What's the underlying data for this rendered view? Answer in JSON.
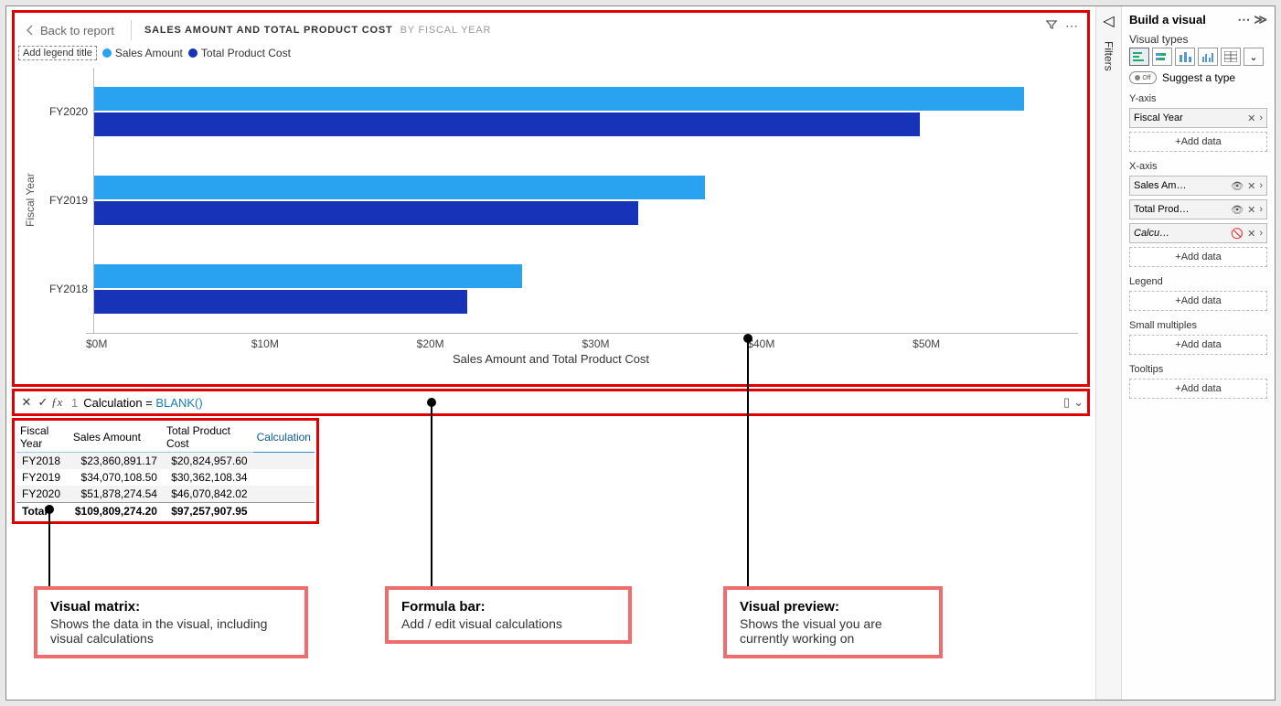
{
  "header": {
    "back_label": "Back to report",
    "title_main": "SALES AMOUNT AND TOTAL PRODUCT COST",
    "title_sub": "BY FISCAL YEAR"
  },
  "legend": {
    "placeholder": "Add legend title",
    "items": [
      {
        "label": "Sales Amount",
        "color": "#29a3ef"
      },
      {
        "label": "Total Product Cost",
        "color": "#1733b8"
      }
    ]
  },
  "chart_data": {
    "type": "bar",
    "orientation": "horizontal",
    "categories": [
      "FY2020",
      "FY2019",
      "FY2018"
    ],
    "series": [
      {
        "name": "Sales Amount",
        "color": "#29a3ef",
        "values": [
          51.88,
          34.07,
          23.86
        ]
      },
      {
        "name": "Total Product Cost",
        "color": "#1733b8",
        "values": [
          46.07,
          30.36,
          20.82
        ]
      }
    ],
    "ylabel": "Fiscal Year",
    "xlabel": "Sales Amount and Total Product Cost",
    "xticks": [
      "$0M",
      "$10M",
      "$20M",
      "$30M",
      "$40M",
      "$50M"
    ],
    "xlim": [
      0,
      55
    ]
  },
  "formula": {
    "line_no": "1",
    "body_plain": "Calculation = ",
    "body_func": "BLANK()"
  },
  "matrix": {
    "headers": [
      "Fiscal Year",
      "Sales Amount",
      "Total Product Cost",
      "Calculation"
    ],
    "rows": [
      {
        "fy": "FY2018",
        "sales": "$23,860,891.17",
        "cost": "$20,824,957.60",
        "calc": ""
      },
      {
        "fy": "FY2019",
        "sales": "$34,070,108.50",
        "cost": "$30,362,108.34",
        "calc": ""
      },
      {
        "fy": "FY2020",
        "sales": "$51,878,274.54",
        "cost": "$46,070,842.02",
        "calc": ""
      }
    ],
    "total": {
      "fy": "Total",
      "sales": "$109,809,274.20",
      "cost": "$97,257,907.95",
      "calc": ""
    }
  },
  "callouts": {
    "matrix": {
      "title": "Visual matrix:",
      "body": "Shows the data in the visual, including visual calculations"
    },
    "formula": {
      "title": "Formula bar:",
      "body": "Add / edit visual calculations"
    },
    "preview": {
      "title": "Visual preview:",
      "body": "Shows the visual you are currently working on"
    }
  },
  "filters_rail": {
    "label": "Filters"
  },
  "panel": {
    "title": "Build a visual",
    "visual_types_label": "Visual types",
    "suggest_label": "Suggest a type",
    "suggest_toggle": "Off",
    "sections": {
      "yaxis": "Y-axis",
      "xaxis": "X-axis",
      "legend": "Legend",
      "small_multiples": "Small multiples",
      "tooltips": "Tooltips"
    },
    "add_data": "+Add data",
    "yaxis_fields": [
      {
        "name": "Fiscal Year",
        "italic": false,
        "icons": [
          "x",
          "chev"
        ]
      }
    ],
    "xaxis_fields": [
      {
        "name": "Sales Am…",
        "italic": false,
        "icons": [
          "eye",
          "x",
          "chev"
        ]
      },
      {
        "name": "Total Prod…",
        "italic": false,
        "icons": [
          "eye",
          "x",
          "chev"
        ]
      },
      {
        "name": "Calcu…",
        "italic": true,
        "icons": [
          "noeye",
          "x",
          "chev"
        ]
      }
    ]
  }
}
